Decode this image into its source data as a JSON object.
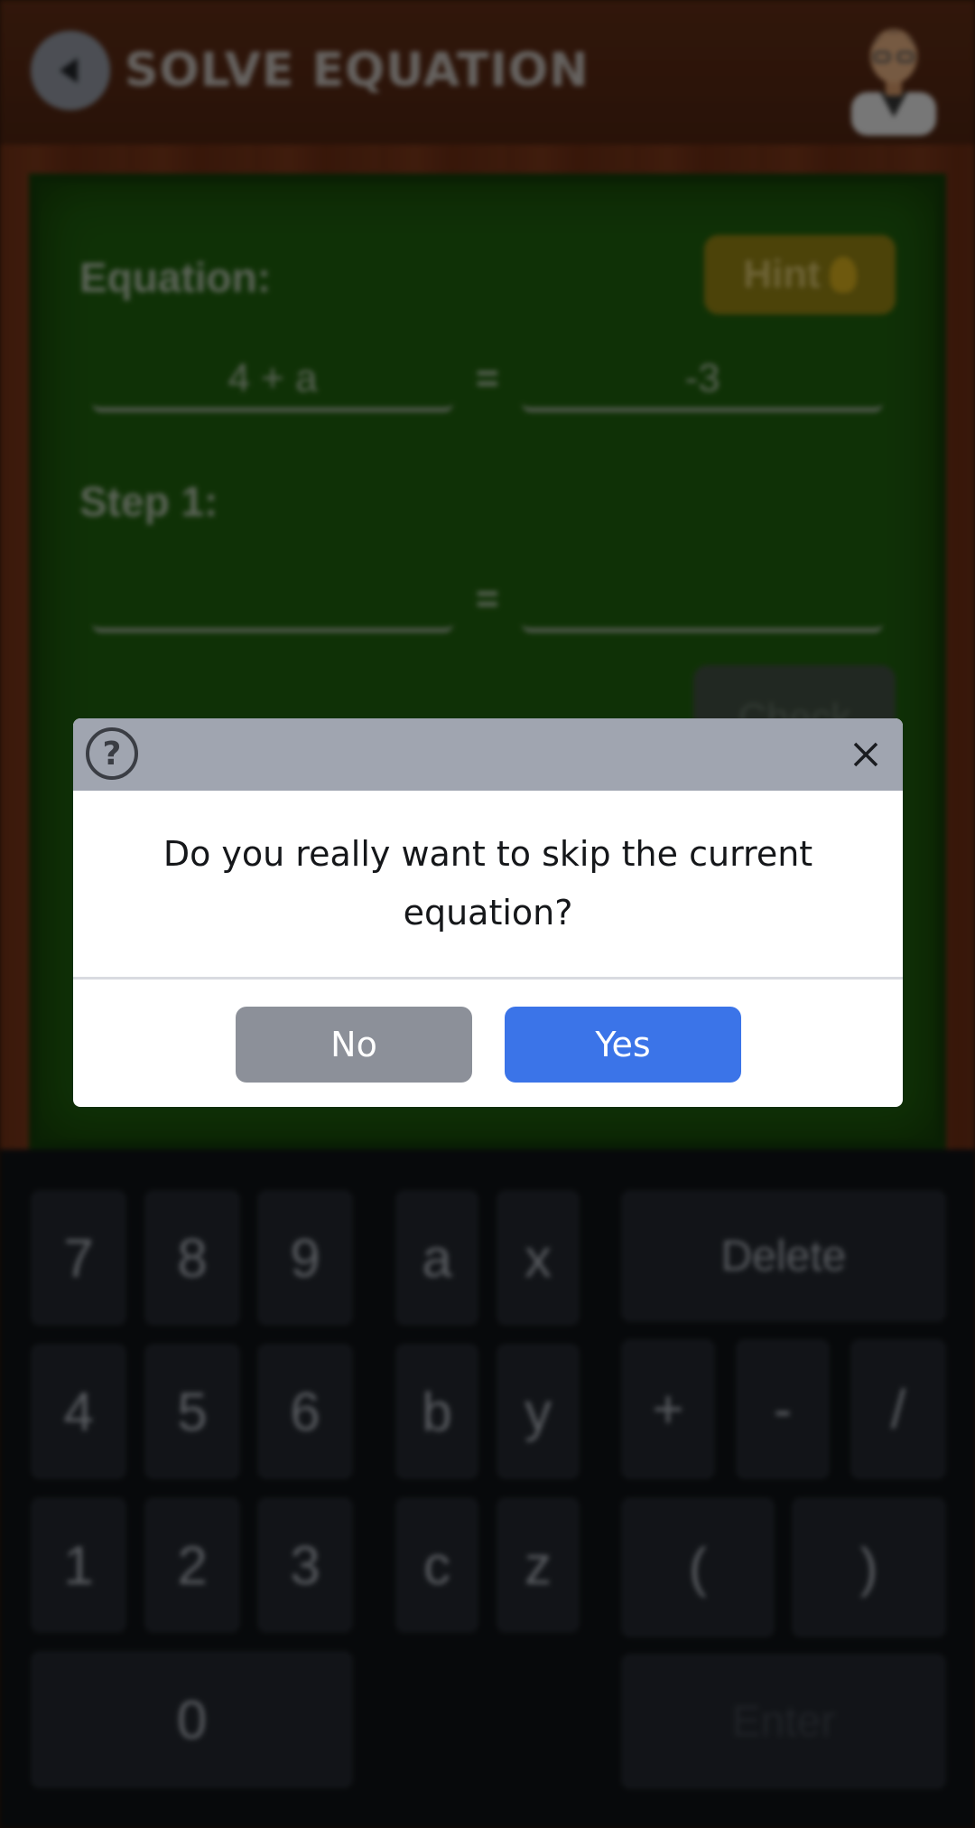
{
  "header": {
    "title": "SOLVE EQUATION"
  },
  "board": {
    "hint_label": "Hint",
    "equation_label": "Equation:",
    "equation_left": "4 + a",
    "equals": "=",
    "equation_right": "-3",
    "step_label": "Step 1:",
    "step_left": "",
    "step_right": "",
    "check_label": "Check"
  },
  "keypad": {
    "digits_row1": [
      "7",
      "8",
      "9"
    ],
    "digits_row2": [
      "4",
      "5",
      "6"
    ],
    "digits_row3": [
      "1",
      "2",
      "3"
    ],
    "zero": "0",
    "vars_row1": [
      "a",
      "x"
    ],
    "vars_row2": [
      "b",
      "y"
    ],
    "vars_row3": [
      "c",
      "z"
    ],
    "delete": "Delete",
    "ops": [
      "+",
      "-",
      "/"
    ],
    "parens": [
      "(",
      ")"
    ],
    "enter": "Enter"
  },
  "dialog": {
    "icon": "question-circle-icon",
    "message": "Do you really want to skip the current equation?",
    "no_label": "No",
    "yes_label": "Yes"
  },
  "colors": {
    "board_green": "#1d5a0c",
    "yes_blue": "#3b74e8",
    "no_gray": "#8c9099",
    "header_gray": "#a0a5b0"
  }
}
